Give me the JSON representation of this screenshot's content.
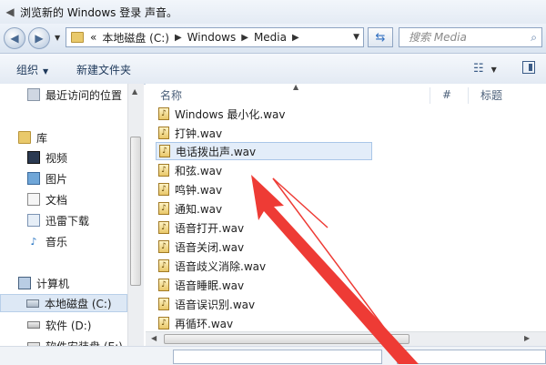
{
  "window": {
    "title": "浏览新的 Windows 登录 声音。"
  },
  "address": {
    "prefix": "«",
    "crumbs": [
      "本地磁盘 (C:)",
      "Windows",
      "Media"
    ],
    "search_placeholder": "搜索 Media"
  },
  "toolbar": {
    "organize_label": "组织",
    "new_folder_label": "新建文件夹"
  },
  "nav": {
    "recent": "最近访问的位置",
    "libraries": "库",
    "video": "视频",
    "pictures": "图片",
    "documents": "文档",
    "downloads": "迅雷下载",
    "music": "音乐",
    "computer": "计算机",
    "drive_c": "本地磁盘 (C:)",
    "drive_d": "软件 (D:)",
    "drive_e": "软件安装盘 (E:)"
  },
  "files": {
    "columns": {
      "name": "名称",
      "num": "#",
      "title": "标题"
    },
    "items": [
      "Windows 最小化.wav",
      "打钟.wav",
      "电话拨出声.wav",
      "和弦.wav",
      "鸣钟.wav",
      "通知.wav",
      "语音打开.wav",
      "语音关闭.wav",
      "语音歧义消除.wav",
      "语音睡眠.wav",
      "语音误识别.wav",
      "再循环.wav"
    ],
    "selected_index": 2
  },
  "colors": {
    "selection": "#e3edf9",
    "annotation": "#ee3b35"
  }
}
